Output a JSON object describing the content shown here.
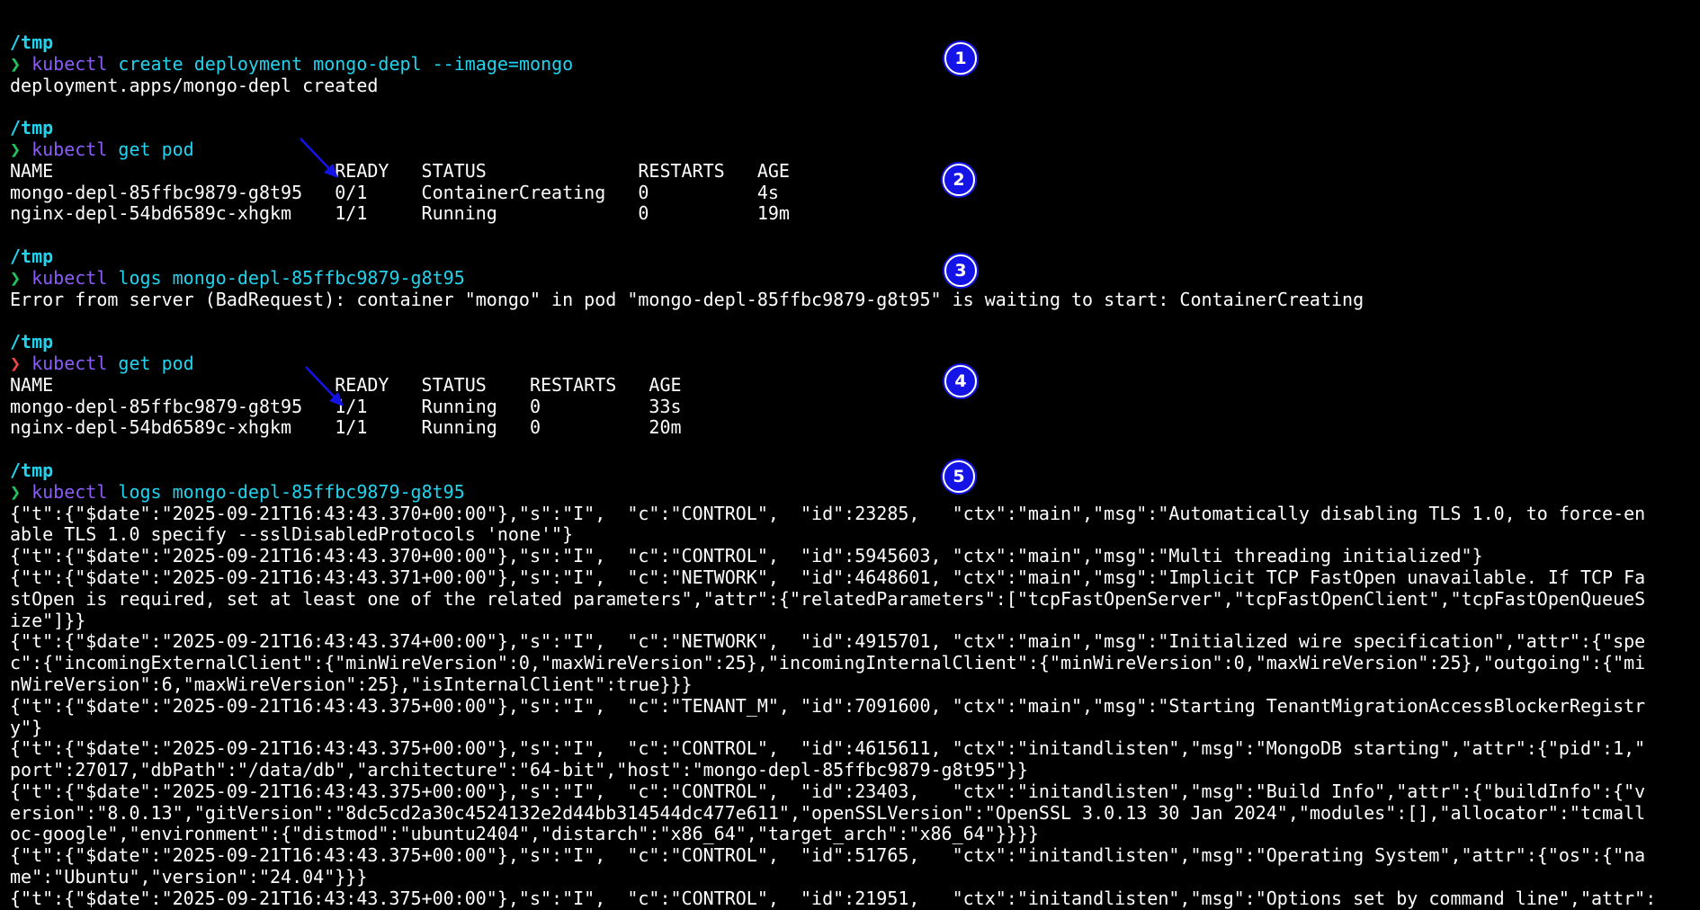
{
  "theme": {
    "background": "#000000",
    "path_color": "#22d3ee",
    "prompt_ok_color": "#22c55e",
    "prompt_err_color": "#ef4444",
    "command_color": "#8b5cf6",
    "arg_color": "#22d3ee",
    "output_color": "#ffffff",
    "annotation_color": "#1414e6"
  },
  "prompt_symbol": "❯",
  "blocks": [
    {
      "cwd": "/tmp",
      "prompt_status": "ok",
      "command": "kubectl",
      "args": " create deployment mongo-depl --image=mongo",
      "output": [
        "deployment.apps/mongo-depl created"
      ]
    },
    {
      "cwd": "/tmp",
      "prompt_status": "ok",
      "command": "kubectl",
      "args": " get pod",
      "output": [
        "NAME                          READY   STATUS              RESTARTS   AGE",
        "mongo-depl-85ffbc9879-g8t95   0/1     ContainerCreating   0          4s",
        "nginx-depl-54bd6589c-xhgkm    1/1     Running             0          19m"
      ]
    },
    {
      "cwd": "/tmp",
      "prompt_status": "ok",
      "command": "kubectl",
      "args": " logs mongo-depl-85ffbc9879-g8t95",
      "output": [
        "Error from server (BadRequest): container \"mongo\" in pod \"mongo-depl-85ffbc9879-g8t95\" is waiting to start: ContainerCreating"
      ]
    },
    {
      "cwd": "/tmp",
      "prompt_status": "err",
      "command": "kubectl",
      "args": " get pod",
      "output": [
        "NAME                          READY   STATUS    RESTARTS   AGE",
        "mongo-depl-85ffbc9879-g8t95   1/1     Running   0          33s",
        "nginx-depl-54bd6589c-xhgkm    1/1     Running   0          20m"
      ]
    },
    {
      "cwd": "/tmp",
      "prompt_status": "ok",
      "command": "kubectl",
      "args": " logs mongo-depl-85ffbc9879-g8t95",
      "output": [
        "{\"t\":{\"$date\":\"2025-09-21T16:43:43.370+00:00\"},\"s\":\"I\",  \"c\":\"CONTROL\",  \"id\":23285,   \"ctx\":\"main\",\"msg\":\"Automatically disabling TLS 1.0, to force-en",
        "able TLS 1.0 specify --sslDisabledProtocols 'none'\"}",
        "{\"t\":{\"$date\":\"2025-09-21T16:43:43.370+00:00\"},\"s\":\"I\",  \"c\":\"CONTROL\",  \"id\":5945603, \"ctx\":\"main\",\"msg\":\"Multi threading initialized\"}",
        "{\"t\":{\"$date\":\"2025-09-21T16:43:43.371+00:00\"},\"s\":\"I\",  \"c\":\"NETWORK\",  \"id\":4648601, \"ctx\":\"main\",\"msg\":\"Implicit TCP FastOpen unavailable. If TCP Fa",
        "stOpen is required, set at least one of the related parameters\",\"attr\":{\"relatedParameters\":[\"tcpFastOpenServer\",\"tcpFastOpenClient\",\"tcpFastOpenQueueS",
        "ize\"]}}",
        "{\"t\":{\"$date\":\"2025-09-21T16:43:43.374+00:00\"},\"s\":\"I\",  \"c\":\"NETWORK\",  \"id\":4915701, \"ctx\":\"main\",\"msg\":\"Initialized wire specification\",\"attr\":{\"spe",
        "c\":{\"incomingExternalClient\":{\"minWireVersion\":0,\"maxWireVersion\":25},\"incomingInternalClient\":{\"minWireVersion\":0,\"maxWireVersion\":25},\"outgoing\":{\"mi",
        "nWireVersion\":6,\"maxWireVersion\":25},\"isInternalClient\":true}}}",
        "{\"t\":{\"$date\":\"2025-09-21T16:43:43.375+00:00\"},\"s\":\"I\",  \"c\":\"TENANT_M\", \"id\":7091600, \"ctx\":\"main\",\"msg\":\"Starting TenantMigrationAccessBlockerRegistr",
        "y\"}",
        "{\"t\":{\"$date\":\"2025-09-21T16:43:43.375+00:00\"},\"s\":\"I\",  \"c\":\"CONTROL\",  \"id\":4615611, \"ctx\":\"initandlisten\",\"msg\":\"MongoDB starting\",\"attr\":{\"pid\":1,\"",
        "port\":27017,\"dbPath\":\"/data/db\",\"architecture\":\"64-bit\",\"host\":\"mongo-depl-85ffbc9879-g8t95\"}}",
        "{\"t\":{\"$date\":\"2025-09-21T16:43:43.375+00:00\"},\"s\":\"I\",  \"c\":\"CONTROL\",  \"id\":23403,   \"ctx\":\"initandlisten\",\"msg\":\"Build Info\",\"attr\":{\"buildInfo\":{\"v",
        "ersion\":\"8.0.13\",\"gitVersion\":\"8dc5cd2a30c4524132e2d44bb314544dc477e611\",\"openSSLVersion\":\"OpenSSL 3.0.13 30 Jan 2024\",\"modules\":[],\"allocator\":\"tcmall",
        "oc-google\",\"environment\":{\"distmod\":\"ubuntu2404\",\"distarch\":\"x86_64\",\"target_arch\":\"x86_64\"}}}}",
        "{\"t\":{\"$date\":\"2025-09-21T16:43:43.375+00:00\"},\"s\":\"I\",  \"c\":\"CONTROL\",  \"id\":51765,   \"ctx\":\"initandlisten\",\"msg\":\"Operating System\",\"attr\":{\"os\":{\"na",
        "me\":\"Ubuntu\",\"version\":\"24.04\"}}}",
        "{\"t\":{\"$date\":\"2025-09-21T16:43:43.375+00:00\"},\"s\":\"I\",  \"c\":\"CONTROL\",  \"id\":21951,   \"ctx\":\"initandlisten\",\"msg\":\"Options set by command line\",\"attr\":"
      ]
    }
  ],
  "annotations": {
    "badges": [
      "1",
      "2",
      "3",
      "4",
      "5"
    ],
    "arrows": [
      "arrow-icon",
      "arrow-icon"
    ]
  }
}
